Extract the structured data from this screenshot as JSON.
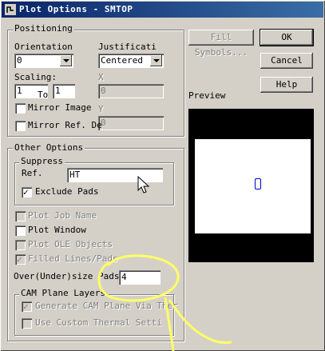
{
  "window": {
    "title": "Plot Options - SMTOP"
  },
  "buttons": {
    "fill_symbols": "Fill Symbols...",
    "ok": "OK",
    "cancel": "Cancel",
    "help": "Help"
  },
  "positioning": {
    "legend": "Positioning",
    "orientation_label": "Orientation",
    "orientation_value": "0",
    "justification_label": "Justificati",
    "justification_value": "Centered",
    "scaling_label": "Scaling:",
    "scaling_from": "1",
    "scaling_to_label": "To",
    "scaling_to": "1",
    "x_label": "X",
    "x_value": "0",
    "y_label": "Y",
    "y_value": "0",
    "mirror_image_label": "Mirror Image",
    "mirror_image_checked": false,
    "mirror_ref_label": "Mirror Ref. De",
    "mirror_ref_checked": false
  },
  "other_options": {
    "legend": "Other Options",
    "suppress_legend": "Suppress",
    "ref_label": "Ref.",
    "ref_value": "HT",
    "exclude_pads_label": "Exclude Pads",
    "exclude_pads_checked": true,
    "plot_job_name_label": "Plot Job Name",
    "plot_window_label": "Plot Window",
    "plot_ole_objects_label": "Plot OLE Objects",
    "filled_lines_label": "Filled Lines/Pads",
    "filled_lines_checked": true,
    "oversize_label": "Over(Under)size Pads",
    "oversize_value": "4",
    "cam_legend": "CAM Plane Layers",
    "generate_cam_label": "Generate CAM Plane Via Ther",
    "generate_cam_checked": true,
    "custom_thermal_label": "Use Custom Thermal Setti"
  },
  "preview": {
    "label": "Preview"
  },
  "colors": {
    "titlebar": "#0a246a",
    "face": "#d4d0c8",
    "annotation": "#ffff66",
    "pad": "#0000c0"
  }
}
